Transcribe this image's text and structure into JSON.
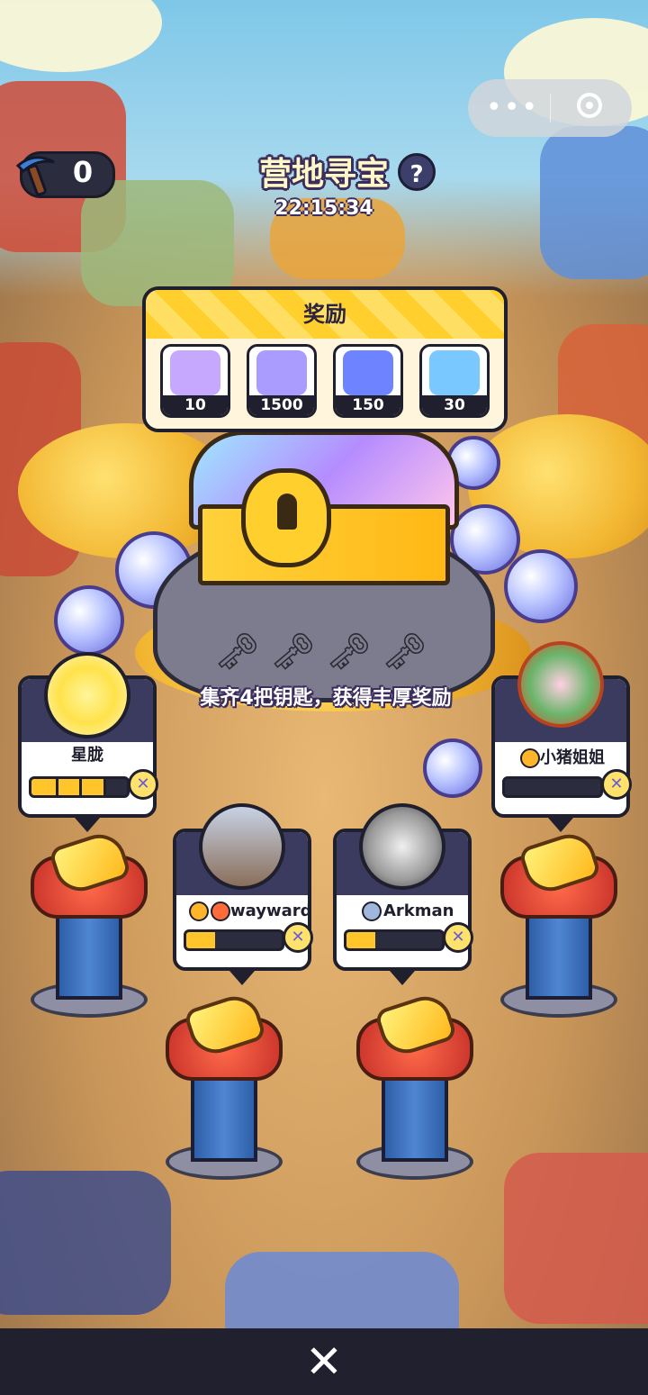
{
  "hud": {
    "pickaxe_count": "0",
    "title": "营地寻宝",
    "help": "?",
    "timer": "22:15:34",
    "capsule_menu": "•••"
  },
  "rewards": {
    "title": "奖励",
    "items": [
      {
        "name": "mystery-box",
        "qty": "10",
        "color": "#c7a8ff"
      },
      {
        "name": "star-orbs",
        "qty": "1500",
        "color": "#a99bff"
      },
      {
        "name": "ticket",
        "qty": "150",
        "color": "#6e83ff"
      },
      {
        "name": "lunchbox",
        "qty": "30",
        "color": "#79c8ff"
      }
    ]
  },
  "key_slots": 4,
  "banner": "集齐4把钥匙，获得丰厚奖励",
  "players": [
    {
      "name": "星胧",
      "progress": 0.75,
      "segments": 4
    },
    {
      "name": "wayward",
      "progress": 0.3,
      "segments": 1
    },
    {
      "name": "Arkman",
      "progress": 0.3,
      "segments": 1
    },
    {
      "name": "小猪姐姐",
      "progress": 0.0,
      "segments": 1
    }
  ],
  "colors": {
    "accent_yellow": "#ffc52b",
    "dark": "#1f1f2e",
    "panel_header": "#ffcf2e"
  }
}
